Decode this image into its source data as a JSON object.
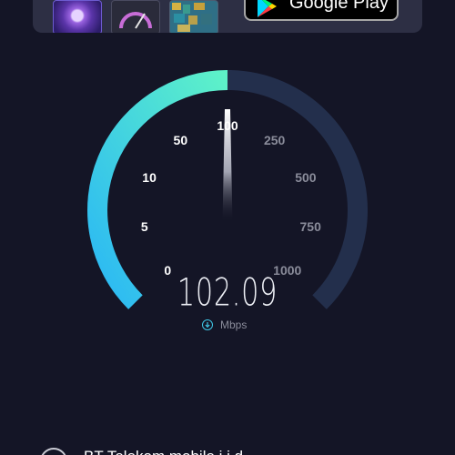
{
  "ad": {
    "store_label": "Google Play",
    "thumbnails": [
      "app-thumbnail-purple",
      "app-thumbnail-speedometer",
      "app-thumbnail-pixel-map"
    ]
  },
  "gauge": {
    "labels": [
      "0",
      "5",
      "10",
      "50",
      "100",
      "250",
      "500",
      "750",
      "1000"
    ],
    "active_labels": [
      "0",
      "5",
      "10",
      "50",
      "100"
    ],
    "current_value": 102.09,
    "colors": {
      "arc_track": "#232f4c",
      "arc_fill_start": "#2ab7f5",
      "arc_fill_end": "#5ef2c8",
      "needle": "#ffffff"
    }
  },
  "speed": {
    "value": "102.09",
    "unit": "Mbps",
    "icon": "download-icon"
  },
  "provider": {
    "name": "BT Telekom mobile i.i.d. ..."
  }
}
